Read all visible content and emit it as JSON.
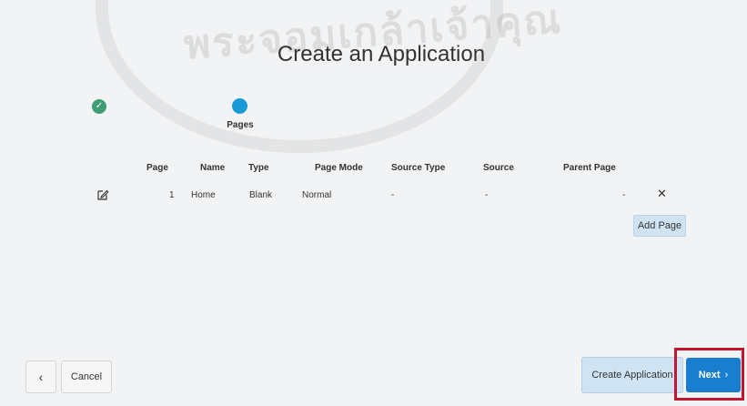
{
  "watermark": {
    "text": "พระจอมเกล้าเจ้าคุณ"
  },
  "page": {
    "title": "Create an Application"
  },
  "wizard": {
    "completed_step_icon": "check-icon",
    "current_step_label": "Pages"
  },
  "table": {
    "headers": [
      "Page",
      "Name",
      "Type",
      "Page Mode",
      "Source Type",
      "Source",
      "Parent Page"
    ],
    "rows": [
      {
        "page": "1",
        "name": "Home",
        "type": "Blank",
        "page_mode": "Normal",
        "source_type": "-",
        "source": "-",
        "parent_page": "-"
      }
    ]
  },
  "icons": {
    "edit": "edit-icon",
    "remove": "close-icon",
    "back": "chevron-left-icon",
    "next": "chevron-right-icon"
  },
  "buttons": {
    "add_page": "Add Page",
    "back": "‹",
    "cancel": "Cancel",
    "create_application": "Create Application",
    "next": "Next",
    "next_chevron": "›"
  },
  "colors": {
    "background": "#f2f3f4",
    "step_done": "#3f9e73",
    "step_current": "#1a9bd7",
    "primary": "#1a7ecf",
    "secondary_button": "#cfe3f3",
    "highlight_border": "#c0162f"
  }
}
